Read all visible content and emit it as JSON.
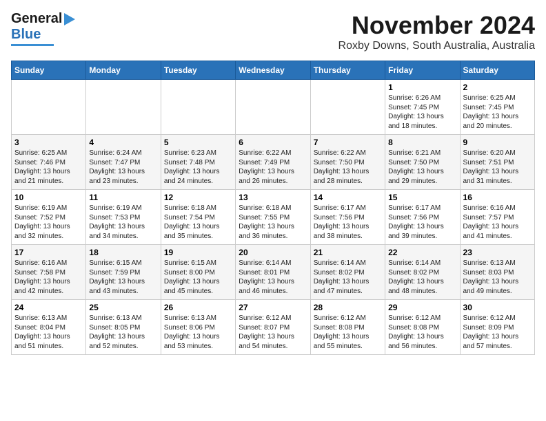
{
  "header": {
    "logo_line1": "General",
    "logo_line2": "Blue",
    "month": "November 2024",
    "location": "Roxby Downs, South Australia, Australia"
  },
  "days_of_week": [
    "Sunday",
    "Monday",
    "Tuesday",
    "Wednesday",
    "Thursday",
    "Friday",
    "Saturday"
  ],
  "weeks": [
    [
      {
        "day": "",
        "info": ""
      },
      {
        "day": "",
        "info": ""
      },
      {
        "day": "",
        "info": ""
      },
      {
        "day": "",
        "info": ""
      },
      {
        "day": "",
        "info": ""
      },
      {
        "day": "1",
        "info": "Sunrise: 6:26 AM\nSunset: 7:45 PM\nDaylight: 13 hours\nand 18 minutes."
      },
      {
        "day": "2",
        "info": "Sunrise: 6:25 AM\nSunset: 7:45 PM\nDaylight: 13 hours\nand 20 minutes."
      }
    ],
    [
      {
        "day": "3",
        "info": "Sunrise: 6:25 AM\nSunset: 7:46 PM\nDaylight: 13 hours\nand 21 minutes."
      },
      {
        "day": "4",
        "info": "Sunrise: 6:24 AM\nSunset: 7:47 PM\nDaylight: 13 hours\nand 23 minutes."
      },
      {
        "day": "5",
        "info": "Sunrise: 6:23 AM\nSunset: 7:48 PM\nDaylight: 13 hours\nand 24 minutes."
      },
      {
        "day": "6",
        "info": "Sunrise: 6:22 AM\nSunset: 7:49 PM\nDaylight: 13 hours\nand 26 minutes."
      },
      {
        "day": "7",
        "info": "Sunrise: 6:22 AM\nSunset: 7:50 PM\nDaylight: 13 hours\nand 28 minutes."
      },
      {
        "day": "8",
        "info": "Sunrise: 6:21 AM\nSunset: 7:50 PM\nDaylight: 13 hours\nand 29 minutes."
      },
      {
        "day": "9",
        "info": "Sunrise: 6:20 AM\nSunset: 7:51 PM\nDaylight: 13 hours\nand 31 minutes."
      }
    ],
    [
      {
        "day": "10",
        "info": "Sunrise: 6:19 AM\nSunset: 7:52 PM\nDaylight: 13 hours\nand 32 minutes."
      },
      {
        "day": "11",
        "info": "Sunrise: 6:19 AM\nSunset: 7:53 PM\nDaylight: 13 hours\nand 34 minutes."
      },
      {
        "day": "12",
        "info": "Sunrise: 6:18 AM\nSunset: 7:54 PM\nDaylight: 13 hours\nand 35 minutes."
      },
      {
        "day": "13",
        "info": "Sunrise: 6:18 AM\nSunset: 7:55 PM\nDaylight: 13 hours\nand 36 minutes."
      },
      {
        "day": "14",
        "info": "Sunrise: 6:17 AM\nSunset: 7:56 PM\nDaylight: 13 hours\nand 38 minutes."
      },
      {
        "day": "15",
        "info": "Sunrise: 6:17 AM\nSunset: 7:56 PM\nDaylight: 13 hours\nand 39 minutes."
      },
      {
        "day": "16",
        "info": "Sunrise: 6:16 AM\nSunset: 7:57 PM\nDaylight: 13 hours\nand 41 minutes."
      }
    ],
    [
      {
        "day": "17",
        "info": "Sunrise: 6:16 AM\nSunset: 7:58 PM\nDaylight: 13 hours\nand 42 minutes."
      },
      {
        "day": "18",
        "info": "Sunrise: 6:15 AM\nSunset: 7:59 PM\nDaylight: 13 hours\nand 43 minutes."
      },
      {
        "day": "19",
        "info": "Sunrise: 6:15 AM\nSunset: 8:00 PM\nDaylight: 13 hours\nand 45 minutes."
      },
      {
        "day": "20",
        "info": "Sunrise: 6:14 AM\nSunset: 8:01 PM\nDaylight: 13 hours\nand 46 minutes."
      },
      {
        "day": "21",
        "info": "Sunrise: 6:14 AM\nSunset: 8:02 PM\nDaylight: 13 hours\nand 47 minutes."
      },
      {
        "day": "22",
        "info": "Sunrise: 6:14 AM\nSunset: 8:02 PM\nDaylight: 13 hours\nand 48 minutes."
      },
      {
        "day": "23",
        "info": "Sunrise: 6:13 AM\nSunset: 8:03 PM\nDaylight: 13 hours\nand 49 minutes."
      }
    ],
    [
      {
        "day": "24",
        "info": "Sunrise: 6:13 AM\nSunset: 8:04 PM\nDaylight: 13 hours\nand 51 minutes."
      },
      {
        "day": "25",
        "info": "Sunrise: 6:13 AM\nSunset: 8:05 PM\nDaylight: 13 hours\nand 52 minutes."
      },
      {
        "day": "26",
        "info": "Sunrise: 6:13 AM\nSunset: 8:06 PM\nDaylight: 13 hours\nand 53 minutes."
      },
      {
        "day": "27",
        "info": "Sunrise: 6:12 AM\nSunset: 8:07 PM\nDaylight: 13 hours\nand 54 minutes."
      },
      {
        "day": "28",
        "info": "Sunrise: 6:12 AM\nSunset: 8:08 PM\nDaylight: 13 hours\nand 55 minutes."
      },
      {
        "day": "29",
        "info": "Sunrise: 6:12 AM\nSunset: 8:08 PM\nDaylight: 13 hours\nand 56 minutes."
      },
      {
        "day": "30",
        "info": "Sunrise: 6:12 AM\nSunset: 8:09 PM\nDaylight: 13 hours\nand 57 minutes."
      }
    ]
  ]
}
